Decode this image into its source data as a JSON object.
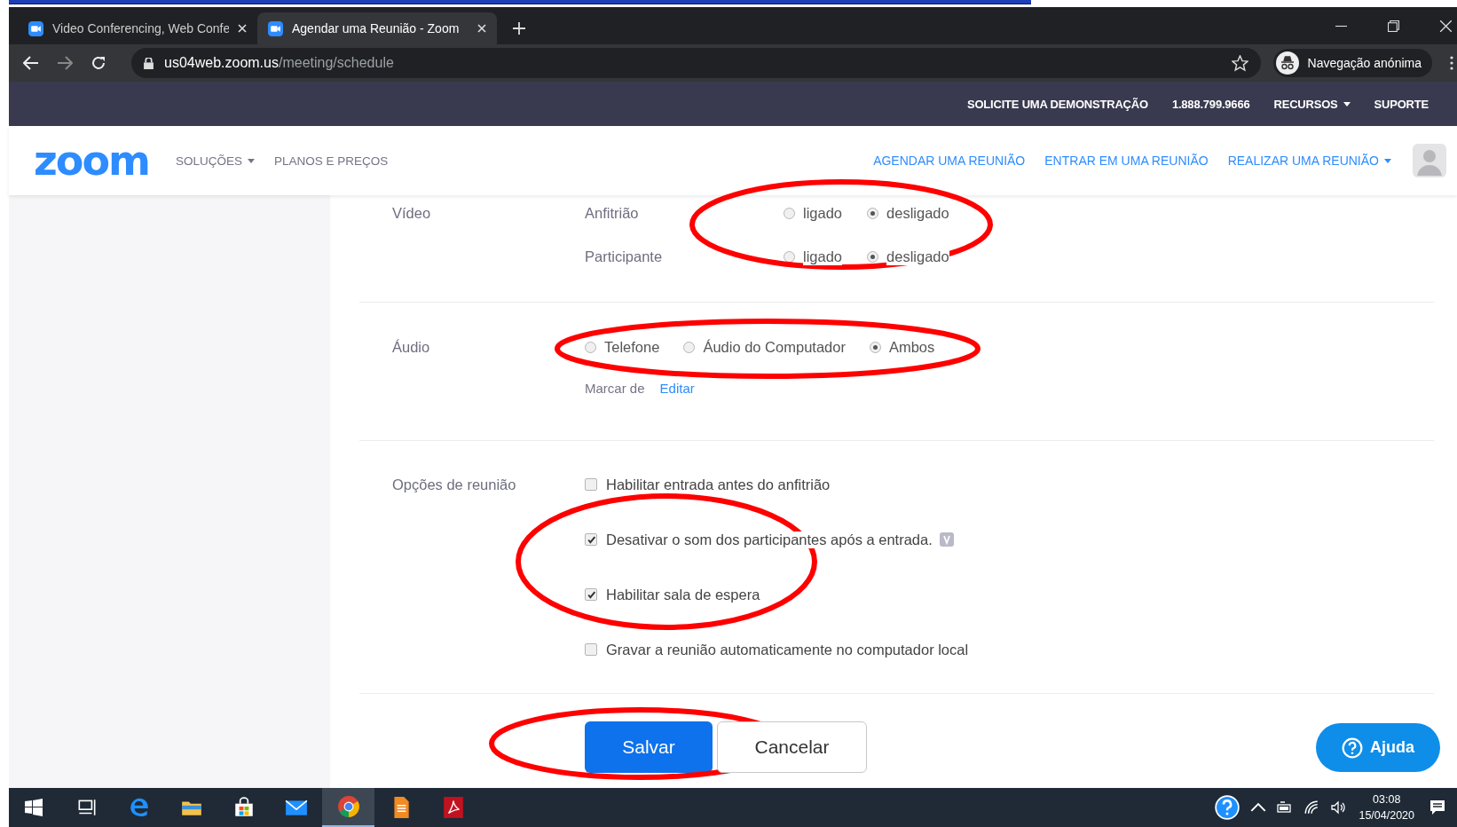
{
  "browser": {
    "tabs": [
      {
        "title": "Video Conferencing, Web Confe",
        "selected": false
      },
      {
        "title": "Agendar uma Reunião - Zoom",
        "selected": true
      }
    ],
    "url_host": "us04web.zoom.us",
    "url_path": "/meeting/schedule",
    "profile": "Navegação anónima"
  },
  "topbar": {
    "links": [
      {
        "label": "SOLICITE UMA DEMONSTRAÇÃO",
        "dropdown": false
      },
      {
        "label": "1.888.799.9666",
        "dropdown": false
      },
      {
        "label": "RECURSOS",
        "dropdown": true
      },
      {
        "label": "SUPORTE",
        "dropdown": false
      }
    ]
  },
  "nav": {
    "logo": "zoom",
    "left": [
      {
        "label": "SOLUÇÕES",
        "dropdown": true
      },
      {
        "label": "PLANOS E PREÇOS",
        "dropdown": false
      }
    ],
    "right": [
      {
        "label": "AGENDAR UMA REUNIÃO",
        "dropdown": false
      },
      {
        "label": "ENTRAR EM UMA REUNIÃO",
        "dropdown": false
      },
      {
        "label": "REALIZAR UMA REUNIÃO",
        "dropdown": true
      }
    ]
  },
  "form": {
    "video": {
      "label": "Vídeo",
      "rows": [
        {
          "label": "Anfitrião",
          "options": [
            {
              "label": "ligado",
              "selected": false
            },
            {
              "label": "desligado",
              "selected": true
            }
          ]
        },
        {
          "label": "Participante",
          "options": [
            {
              "label": "ligado",
              "selected": false
            },
            {
              "label": "desligado",
              "selected": true
            }
          ]
        }
      ]
    },
    "audio": {
      "label": "Áudio",
      "options": [
        {
          "label": "Telefone",
          "selected": false
        },
        {
          "label": "Áudio do Computador",
          "selected": false
        },
        {
          "label": "Ambos",
          "selected": true
        }
      ],
      "note": "Marcar de",
      "link": "Editar"
    },
    "meeting_options": {
      "label": "Opções de reunião",
      "items": [
        {
          "label": "Habilitar entrada antes do anfitrião",
          "checked": false,
          "info": false
        },
        {
          "label": "Desativar o som dos participantes após a entrada.",
          "checked": true,
          "info": true
        },
        {
          "label": "Habilitar sala de espera",
          "checked": true,
          "info": false
        },
        {
          "label": "Gravar a reunião automaticamente no computador local",
          "checked": false,
          "info": false
        }
      ]
    },
    "buttons": {
      "save": "Salvar",
      "cancel": "Cancelar"
    }
  },
  "help_button": "Ajuda",
  "taskbar": {
    "apps": [
      {
        "kind": "taskview",
        "active": false
      },
      {
        "kind": "edge",
        "active": false
      },
      {
        "kind": "folder",
        "active": false
      },
      {
        "kind": "store",
        "active": false
      },
      {
        "kind": "mail",
        "active": false
      },
      {
        "kind": "chrome",
        "active": true
      },
      {
        "kind": "document",
        "active": false
      },
      {
        "kind": "pdf",
        "active": false
      }
    ],
    "time": "03:08",
    "date": "15/04/2020"
  }
}
